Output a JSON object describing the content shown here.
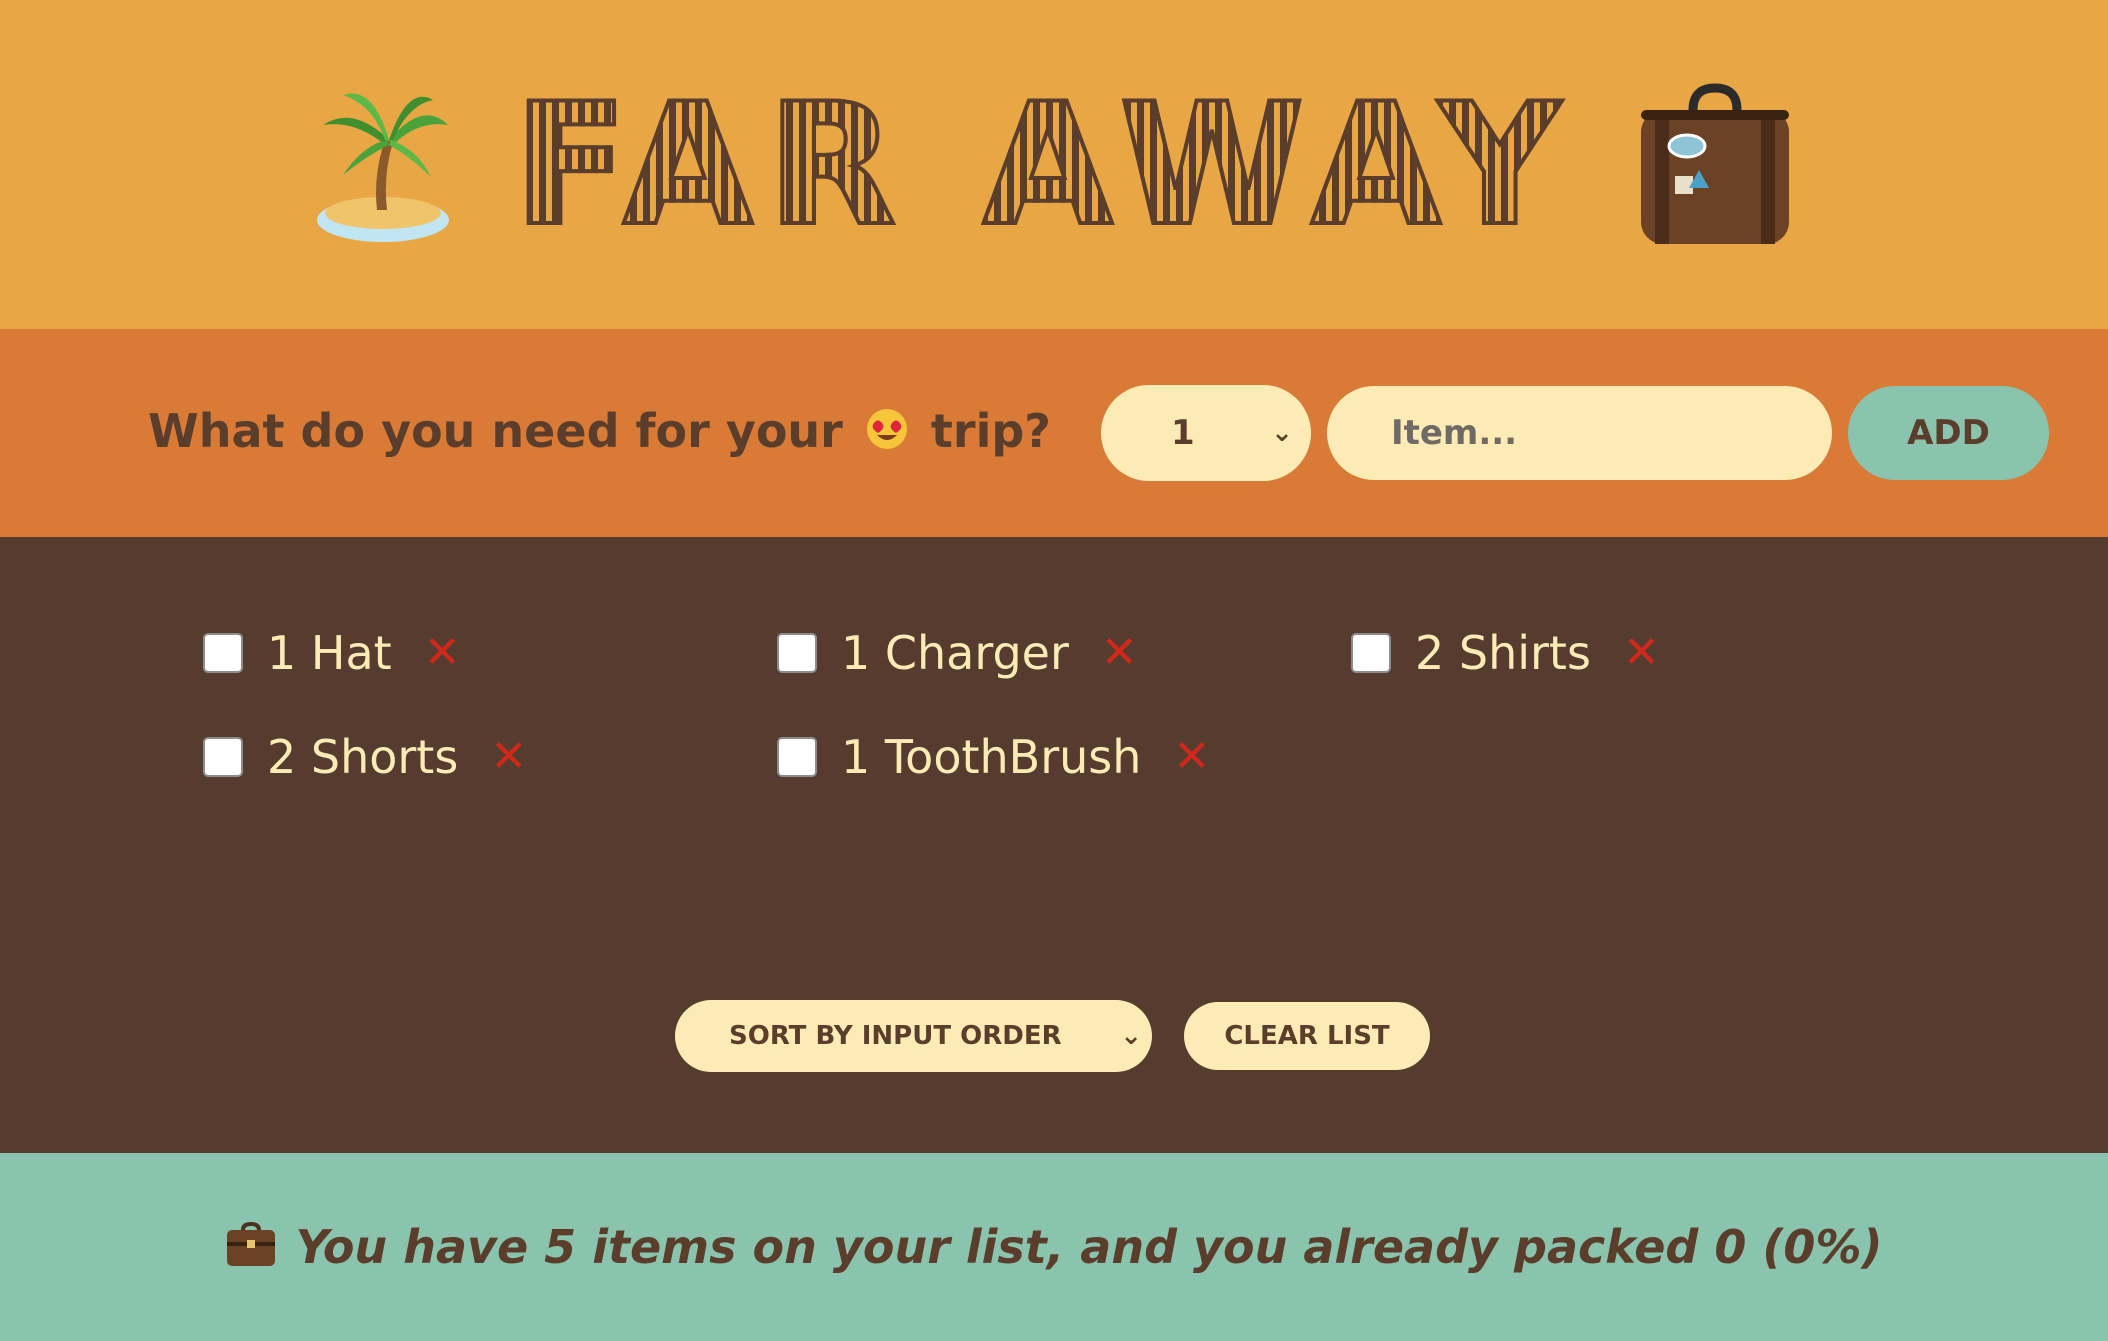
{
  "header": {
    "title": "FAR AWAY",
    "left_icon": "palm-island-icon",
    "right_icon": "suitcase-icon"
  },
  "form": {
    "prompt_before": "What do you need for your",
    "prompt_after": "trip?",
    "prompt_icon": "heart-eyes-face-icon",
    "quantity": "1",
    "item_placeholder": "Item...",
    "add_label": "ADD"
  },
  "items": [
    {
      "label": "1 Hat",
      "packed": false
    },
    {
      "label": "1 Charger",
      "packed": false
    },
    {
      "label": "2 Shirts",
      "packed": false
    },
    {
      "label": "2 Shorts",
      "packed": false
    },
    {
      "label": "1 ToothBrush",
      "packed": false
    }
  ],
  "actions": {
    "sort_label": "SORT BY INPUT ORDER",
    "clear_label": "CLEAR LIST"
  },
  "stats": {
    "icon": "briefcase-icon",
    "text": "You have 5 items on your list, and you already packed 0 (0%)"
  },
  "colors": {
    "header_bg": "#e9a644",
    "form_bg": "#d97a36",
    "list_bg": "#553c2f",
    "stats_bg": "#8ac4ae",
    "cream": "#fdebb6",
    "delete_red": "#d0291c"
  }
}
